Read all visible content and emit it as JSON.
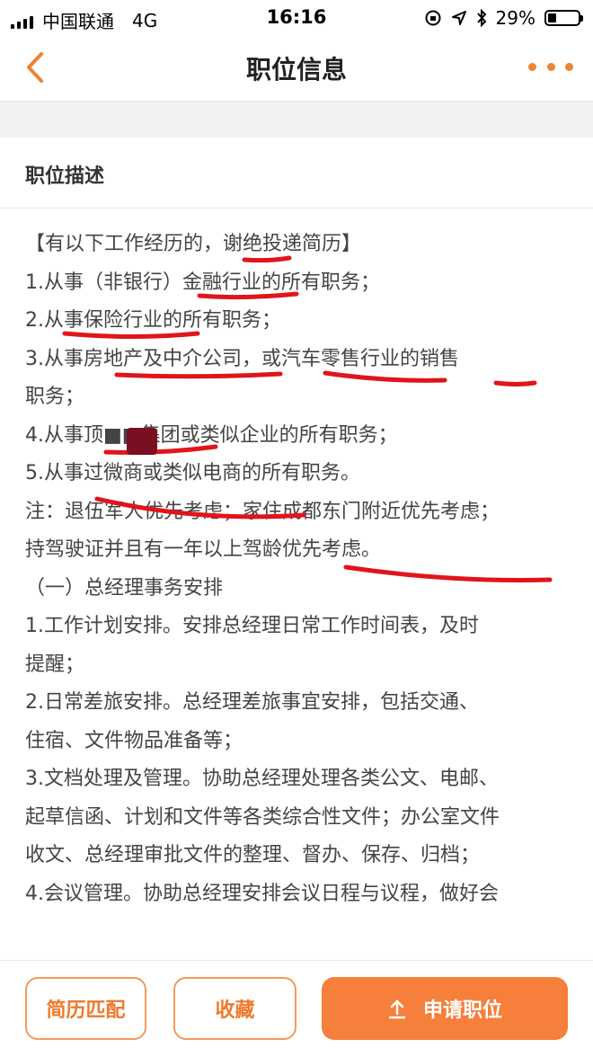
{
  "status_bar": {
    "carrier": "中国联通",
    "network": "4G",
    "time": "16:16",
    "battery": "29%",
    "battery_level": 0.29
  },
  "navbar": {
    "title": "职位信息",
    "back_icon": "chevron-left-icon",
    "more_icon": "more-dots-icon",
    "accent_color": "#f08332"
  },
  "section": {
    "title": "职位描述"
  },
  "description_lines": [
    "【有以下工作经历的，谢绝投递简历】",
    "1.从事（非银行）金融行业的所有职务；",
    "2.从事保险行业的所有职务；",
    "3.从事房地产及中介公司，或汽车零售行业的销售",
    "职务；",
    "4.从事顶■■集团或类似企业的所有职务；",
    "5.从事过微商或类似电商的所有职务。",
    "",
    "注：退伍军人优先考虑；家住成都东门附近优先考虑；",
    "持驾驶证并且有一年以上驾龄优先考虑。",
    "（一）总经理事务安排",
    "1.工作计划安排。安排总经理日常工作时间表，及时",
    "提醒；",
    "2.日常差旅安排。总经理差旅事宜安排，包括交通、",
    "住宿、文件物品准备等；",
    "3.文档处理及管理。协助总经理处理各类公文、电邮、",
    "起草信函、计划和文件等各类综合性文件；办公室文件",
    "收文、总经理审批文件的整理、督办、保存、归档；",
    "4.会议管理。协助总经理安排会议日程与议程，做好会"
  ],
  "bottom_bar": {
    "resume_match": "简历匹配",
    "favorite": "收藏",
    "apply": "申请职位",
    "apply_icon": "upload-icon",
    "primary_color": "#f57f3b"
  }
}
